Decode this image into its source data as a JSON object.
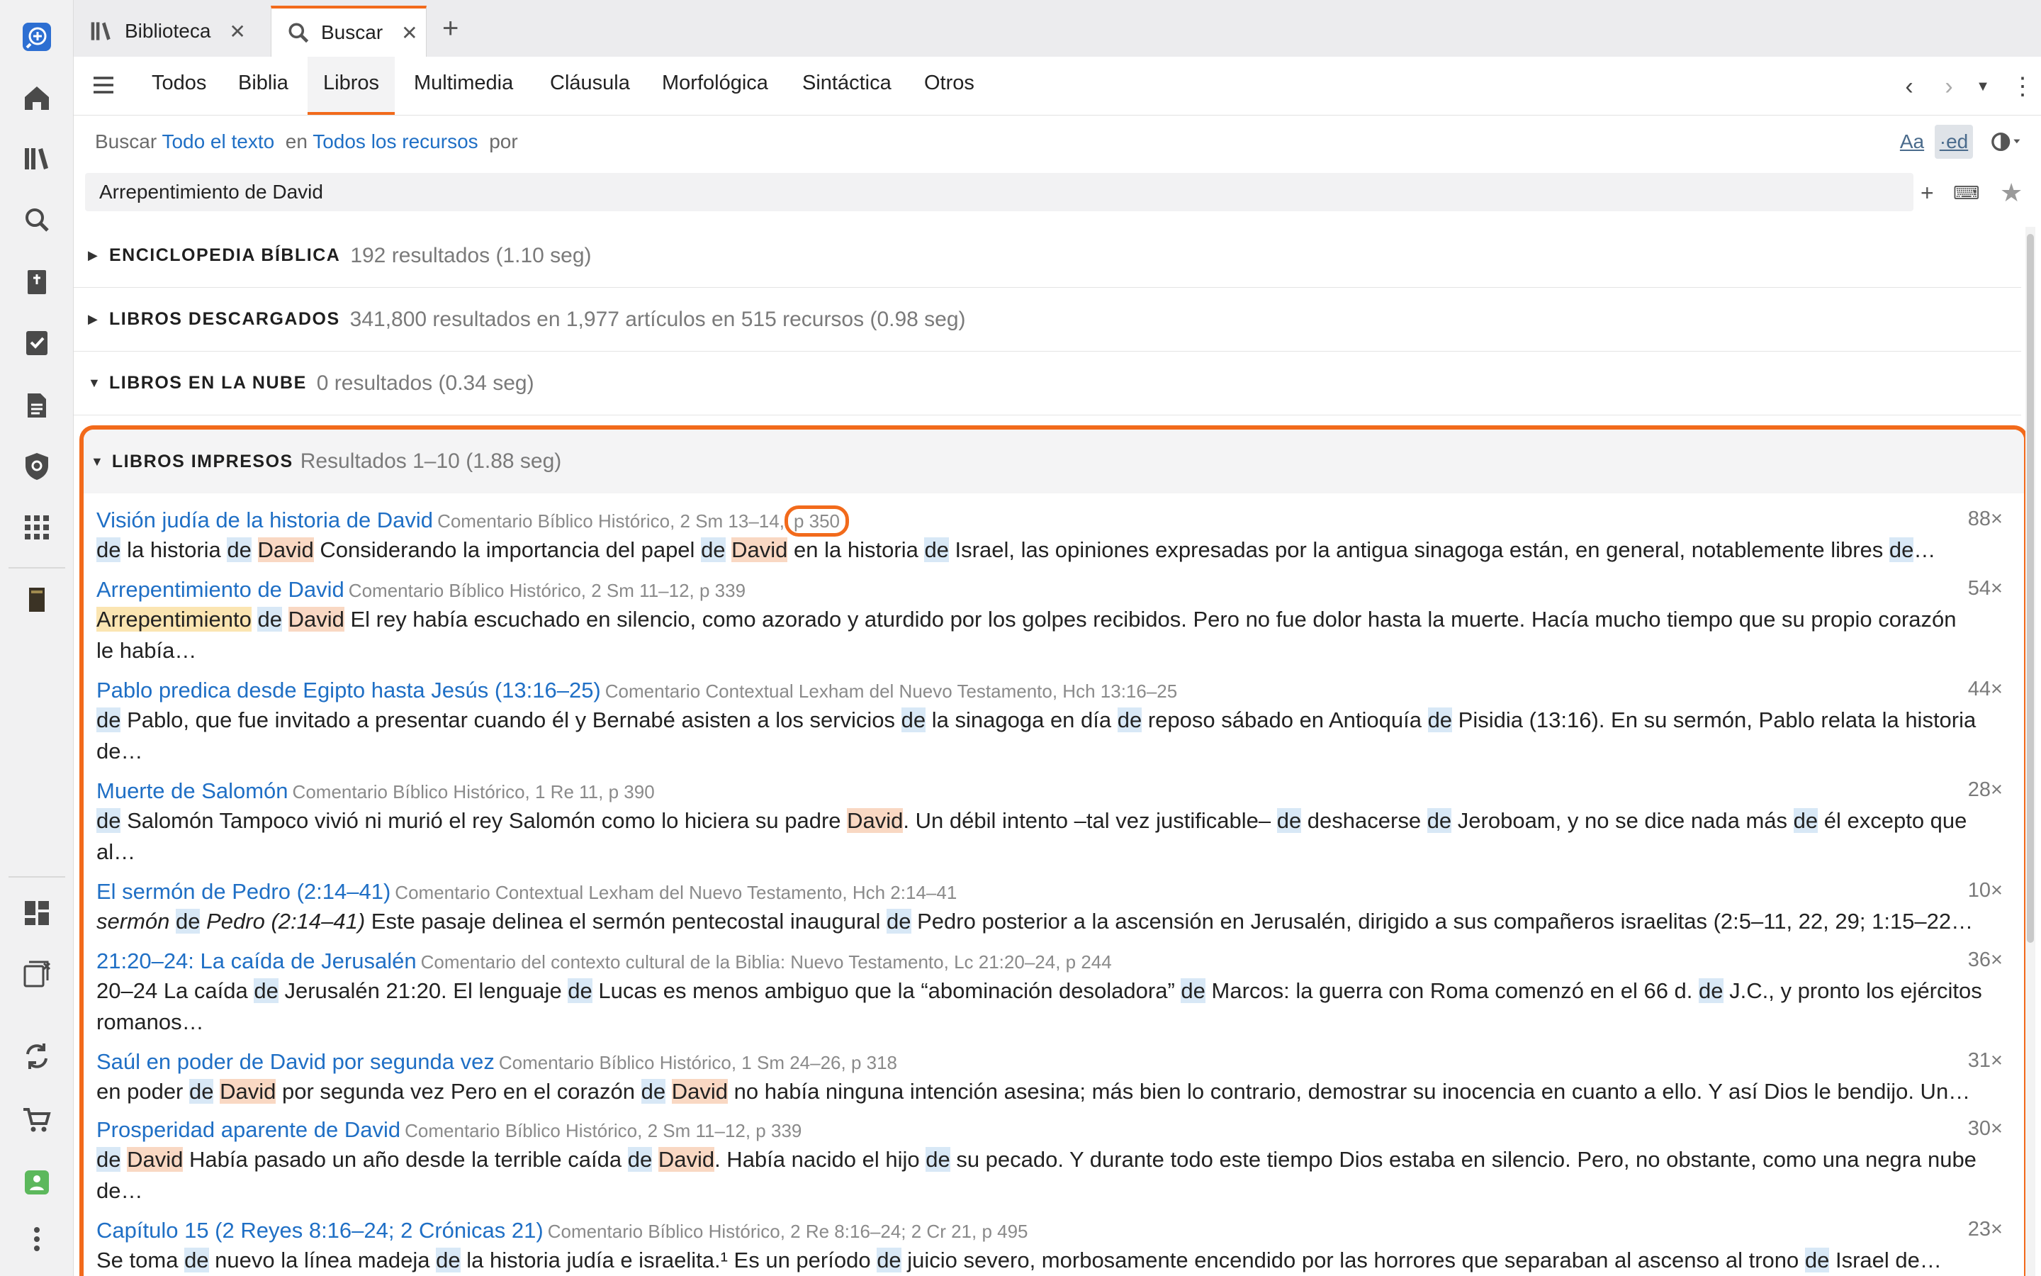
{
  "tabs": [
    {
      "label": "Biblioteca",
      "icon": "library-icon"
    },
    {
      "label": "Buscar",
      "icon": "search-icon"
    }
  ],
  "categories": [
    "Todos",
    "Biblia",
    "Libros",
    "Multimedia",
    "Cláusula",
    "Morfológica",
    "Sintáctica",
    "Otros"
  ],
  "criteria": {
    "prefix": "Buscar",
    "scope": "Todo el texto",
    "in_word": "en",
    "resources": "Todos los recursos",
    "by_word": "por"
  },
  "search": {
    "query": "Arrepentimiento de David"
  },
  "sections": [
    {
      "name": "ENCICLOPEDIA BÍBLICA",
      "info": "192 resultados (1.10 seg)",
      "expanded": false
    },
    {
      "name": "LIBROS DESCARGADOS",
      "info": "341,800 resultados en 1,977 artículos en 515 recursos (0.98 seg)",
      "expanded": false
    },
    {
      "name": "LIBROS EN LA NUBE",
      "info": "0 resultados (0.34 seg)",
      "expanded": true
    },
    {
      "name": "LIBROS IMPRESOS",
      "info": "Resultados 1–10 (1.88 seg)",
      "expanded": true
    }
  ],
  "results": [
    {
      "title": "Visión judía de la historia de David",
      "source": "Comentario Bíblico Histórico, 2 Sm 13–14,",
      "page": "p 350",
      "count": "88×",
      "text": [
        "[de] la historia [de] {David} Considerando la importancia del papel [de] {David} en la historia [de] Israel, las opiniones expresadas por la antigua sinagoga están, en general, notablemente libres [de]…"
      ]
    },
    {
      "title": "Arrepentimiento de David",
      "source": "Comentario Bíblico Histórico, 2 Sm 11–12, p 339",
      "count": "54×",
      "text": [
        "<Arrepentimiento> [de] {David} El rey había escuchado en silencio, como azorado y aturdido por los golpes recibidos. Pero no fue dolor hasta la muerte. Hacía mucho tiempo que su propio corazón",
        "le había…"
      ]
    },
    {
      "title": "Pablo predica desde Egipto hasta Jesús (13:16–25)",
      "source": "Comentario Contextual Lexham del Nuevo Testamento, Hch 13:16–25",
      "count": "44×",
      "text": [
        "[de] Pablo, que fue invitado a presentar cuando él y Bernabé asisten a los servicios [de] la sinagoga en día [de] reposo sábado en Antioquía [de] Pisidia (13:16). En su sermón, Pablo relata la historia",
        "de…"
      ]
    },
    {
      "title": "Muerte de Salomón",
      "source": "Comentario Bíblico Histórico, 1 Re 11, p 390",
      "count": "28×",
      "text": [
        "[de] Salomón Tampoco vivió ni murió el rey Salomón como lo hiciera su padre {David}. Un débil intento –tal vez justificable– [de] deshacerse [de] Jeroboam, y no se dice nada más [de] él excepto que",
        "al…"
      ]
    },
    {
      "title": "El sermón de Pedro (2:14–41)",
      "source": "Comentario Contextual Lexham del Nuevo Testamento, Hch 2:14–41",
      "count": "10×",
      "text": [
        "_sermón_ [de] _Pedro (2:14–41)_ Este pasaje delinea el sermón pentecostal inaugural [de] Pedro posterior a la ascensión en Jerusalén, dirigido a sus compañeros israelitas (2:5–11, 22, 29; 1:15–22…"
      ]
    },
    {
      "title": "21:20–24: La caída de Jerusalén",
      "source": "Comentario del contexto cultural de la Biblia: Nuevo Testamento, Lc 21:20–24, p 244",
      "count": "36×",
      "text": [
        "20–24 La caída [de] Jerusalén 21:20. El lenguaje [de] Lucas es menos ambiguo que la “abominación desoladora” [de] Marcos: la guerra con Roma comenzó en el 66 d. [de] J.C., y pronto los ejércitos",
        "romanos…"
      ]
    },
    {
      "title": "Saúl en poder de David por segunda vez",
      "source": "Comentario Bíblico Histórico, 1 Sm 24–26, p 318",
      "count": "31×",
      "text": [
        "en poder [de] {David} por segunda vez Pero en el corazón [de] {David} no había ninguna intención asesina; más bien lo contrario, demostrar su inocencia en cuanto a ello. Y así Dios le bendijo. Un…"
      ]
    },
    {
      "title": "Prosperidad aparente de David",
      "source": "Comentario Bíblico Histórico, 2 Sm 11–12, p 339",
      "count": "30×",
      "text": [
        "[de] {David} Había pasado un año desde la terrible caída [de] {David}. Había nacido el hijo [de] su pecado. Y durante todo este tiempo Dios estaba en silencio. Pero, no obstante, como una negra nube",
        "de…"
      ]
    },
    {
      "title": "Capítulo 15 (2 Reyes 8:16–24; 2 Crónicas 21)",
      "source": "Comentario Bíblico Histórico, 2 Re 8:16–24; 2 Cr 21, p 495",
      "count": "23×",
      "text": [
        "Se toma [de] nuevo la línea madeja [de] la historia judía e israelita.¹ Es un período [de] juicio severo, morbosamente encendido por las horrores que separaban al ascenso al trono [de] Israel de…"
      ]
    }
  ],
  "colors": {
    "accent": "#f26a1b",
    "link": "#1f6fc5",
    "hl_de": "#d8e8f6",
    "hl_david": "#f9d8c3",
    "hl_arrep": "#fbe5b2"
  }
}
